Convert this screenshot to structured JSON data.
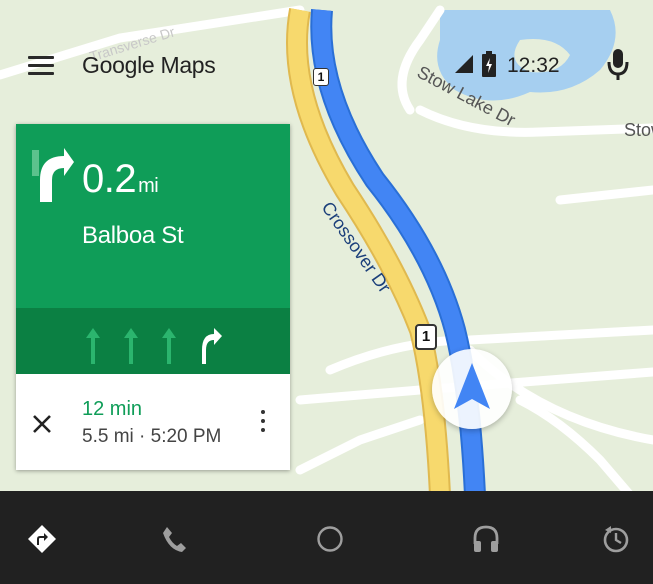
{
  "app": {
    "title": "Google Maps"
  },
  "status": {
    "time": "12:32"
  },
  "map": {
    "labels": {
      "transverse": "Transverse Dr",
      "stow_lake": "Stow Lake Dr",
      "stow_edge": "Stow",
      "crossover": "Crossover Dr",
      "route_shield": "1"
    }
  },
  "navigation": {
    "distance": "0.2",
    "unit": "mi",
    "street": "Balboa St",
    "lanes": [
      "straight",
      "straight",
      "straight",
      "right"
    ]
  },
  "trip": {
    "eta_duration": "12 min",
    "eta_detail": "5.5 mi · 5:20 PM"
  },
  "icons": {
    "menu": "menu-icon",
    "signal": "signal-icon",
    "battery": "battery-icon",
    "mic": "mic-icon",
    "turn": "turn-right-icon",
    "close": "close-icon",
    "more": "more-vert-icon",
    "navigation": "navigation-icon",
    "phone": "phone-icon",
    "home": "home-circle-icon",
    "audio": "headphones-icon",
    "recent": "recent-icon"
  },
  "colors": {
    "map_background": "#e6eedb",
    "route": "#4285f4",
    "primary_road": "#f7d96d",
    "turn_panel": "#0f9d58",
    "lane_panel": "#0b8043",
    "eta_text": "#0f9d58",
    "bottom_bar": "#212121"
  }
}
